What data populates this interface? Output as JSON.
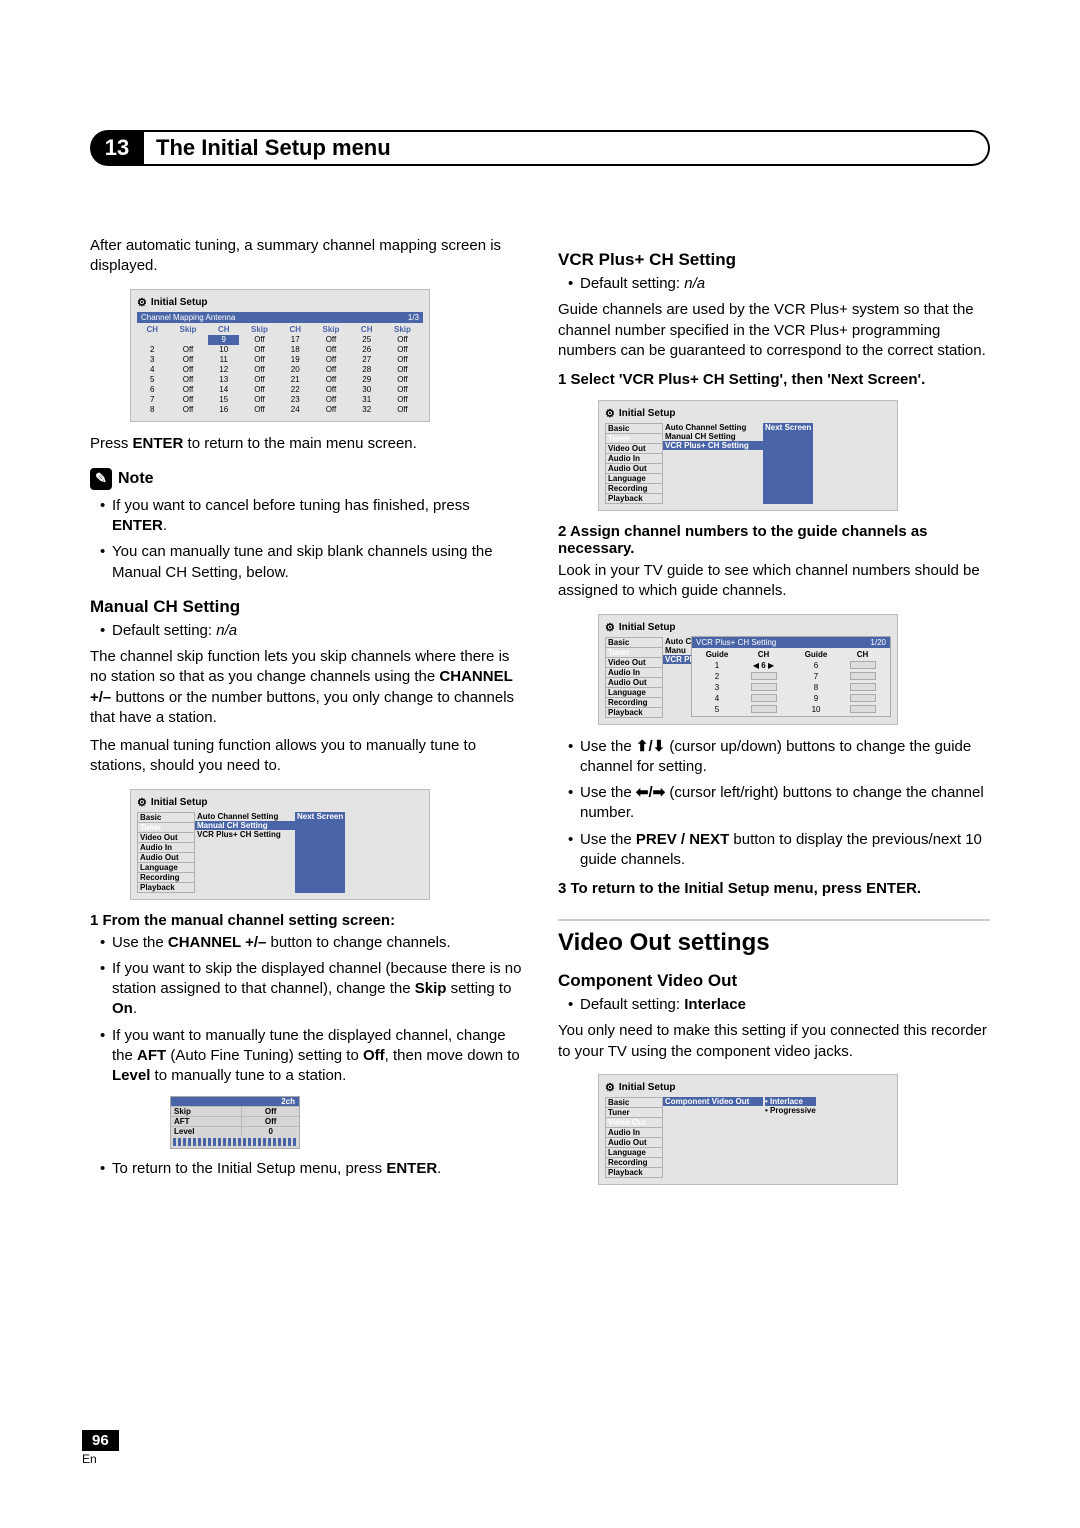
{
  "chapter": {
    "num": "13",
    "title": "The Initial Setup menu"
  },
  "left": {
    "intro": "After automatic tuning, a summary channel mapping screen is displayed.",
    "osd1": {
      "title": "Initial Setup",
      "bar_left": "Channel Mapping Antenna",
      "bar_right": "1/3",
      "header": [
        "CH",
        "Skip",
        "CH",
        "Skip",
        "CH",
        "Skip",
        "CH",
        "Skip"
      ],
      "rows": [
        [
          "",
          "",
          "9",
          "Off",
          "17",
          "Off",
          "25",
          "Off"
        ],
        [
          "2",
          "Off",
          "10",
          "Off",
          "18",
          "Off",
          "26",
          "Off"
        ],
        [
          "3",
          "Off",
          "11",
          "Off",
          "19",
          "Off",
          "27",
          "Off"
        ],
        [
          "4",
          "Off",
          "12",
          "Off",
          "20",
          "Off",
          "28",
          "Off"
        ],
        [
          "5",
          "Off",
          "13",
          "Off",
          "21",
          "Off",
          "29",
          "Off"
        ],
        [
          "6",
          "Off",
          "14",
          "Off",
          "22",
          "Off",
          "30",
          "Off"
        ],
        [
          "7",
          "Off",
          "15",
          "Off",
          "23",
          "Off",
          "31",
          "Off"
        ],
        [
          "8",
          "Off",
          "16",
          "Off",
          "24",
          "Off",
          "32",
          "Off"
        ]
      ]
    },
    "press_enter_pre": "Press ",
    "press_enter_bold": "ENTER",
    "press_enter_post": " to return to the main menu screen.",
    "note_label": "Note",
    "note1a": "If you want to cancel before tuning has finished, press ",
    "note1b": "ENTER",
    "note1c": ".",
    "note2": "You can manually tune and skip blank channels using the Manual CH Setting, below.",
    "manual_h": "Manual CH Setting",
    "default_setting": "Default setting: ",
    "na": "n/a",
    "manual_p1a": "The channel skip function lets you skip channels where there is no station so that as you change channels using the ",
    "manual_p1b": "CHANNEL +/–",
    "manual_p1c": " buttons or the number buttons, you only change to channels that have a station.",
    "manual_p2": "The manual tuning function allows you to manually tune to stations, should you need to.",
    "osd2": {
      "title": "Initial Setup",
      "cats": [
        "Basic",
        "Tuner",
        "Video Out",
        "Audio In",
        "Audio Out",
        "Language",
        "Recording",
        "Playback"
      ],
      "subs": [
        "Auto Channel Setting",
        "Manual CH Setting",
        "VCR Plus+ CH Setting"
      ],
      "opt": "Next Screen"
    },
    "step1": "1   From the manual channel setting screen:",
    "step1_b1a": "Use the ",
    "step1_b1b": "CHANNEL +/–",
    "step1_b1c": " button to change channels.",
    "step1_b2a": "If you want to skip the displayed channel (because there is no station assigned to that channel), change the ",
    "step1_b2b": "Skip",
    "step1_b2c": " setting to ",
    "step1_b2d": "On",
    "step1_b2e": ".",
    "step1_b3a": "If you want to manually tune the displayed channel, change the ",
    "step1_b3b": "AFT",
    "step1_b3c": " (Auto Fine Tuning) setting to ",
    "step1_b3d": "Off",
    "step1_b3e": ", then move down to ",
    "step1_b3f": "Level",
    "step1_b3g": " to manually tune to a station.",
    "osd3": {
      "bar": "2ch",
      "rows": [
        [
          "Skip",
          "Off"
        ],
        [
          "AFT",
          "Off"
        ],
        [
          "Level",
          "0"
        ]
      ]
    },
    "ret_a": "To return to the Initial Setup menu, press ",
    "ret_b": "ENTER",
    "ret_c": "."
  },
  "right": {
    "vcr_h": "VCR Plus+ CH Setting",
    "default_setting": "Default setting: ",
    "na": "n/a",
    "vcr_p": "Guide channels are used by the VCR Plus+ system so that the channel number specified in the VCR Plus+ programming numbers can be guaranteed to correspond to the correct station.",
    "step1": "1   Select 'VCR Plus+ CH Setting', then 'Next Screen'.",
    "osd1": {
      "title": "Initial Setup",
      "cats": [
        "Basic",
        "Tuner",
        "Video Out",
        "Audio In",
        "Audio Out",
        "Language",
        "Recording",
        "Playback"
      ],
      "subs": [
        "Auto Channel Setting",
        "Manual CH Setting",
        "VCR Plus+ CH Setting"
      ],
      "opt": "Next Screen"
    },
    "step2": "2   Assign channel numbers to the guide channels as necessary.",
    "step2_p": "Look in your TV guide to see which channel numbers should be assigned to which guide channels.",
    "osd2": {
      "title": "Initial Setup",
      "cats": [
        "Basic",
        "Tuner",
        "Video Out",
        "Audio In",
        "Audio Out",
        "Language",
        "Recording",
        "Playback"
      ],
      "subs": [
        "Auto C",
        "Manu",
        "VCR Pl"
      ],
      "pop_title": "VCR Plus+ CH Setting",
      "pop_page": "1/20",
      "header": [
        "Guide",
        "CH",
        "Guide",
        "CH"
      ],
      "rows": [
        [
          "1",
          "6",
          "6",
          ""
        ],
        [
          "2",
          "",
          "7",
          ""
        ],
        [
          "3",
          "",
          "8",
          ""
        ],
        [
          "4",
          "",
          "9",
          ""
        ],
        [
          "5",
          "",
          "10",
          ""
        ]
      ]
    },
    "b1a": "Use the ",
    "b1b": " (cursor up/down) buttons to change the guide channel for setting.",
    "b2a": "Use the ",
    "b2b": " (cursor left/right) buttons to change the channel number.",
    "b3a": "Use the ",
    "b3b": "PREV / NEXT",
    "b3c": " button to display the previous/next 10 guide channels.",
    "step3": "3   To return to the Initial Setup menu, press ENTER.",
    "video_h": "Video Out settings",
    "comp_h": "Component Video Out",
    "comp_default": "Default setting: ",
    "interlace": "Interlace",
    "comp_p": "You only need to make this setting if you connected this recorder to your TV using the component video jacks.",
    "osd3": {
      "title": "Initial Setup",
      "cats": [
        "Basic",
        "Tuner",
        "Video Out",
        "Audio In",
        "Audio Out",
        "Language",
        "Recording",
        "Playback"
      ],
      "sub": "Component Video Out",
      "opts": [
        "Interlace",
        "Progressive"
      ]
    }
  },
  "foot": {
    "page": "96",
    "lang": "En"
  }
}
